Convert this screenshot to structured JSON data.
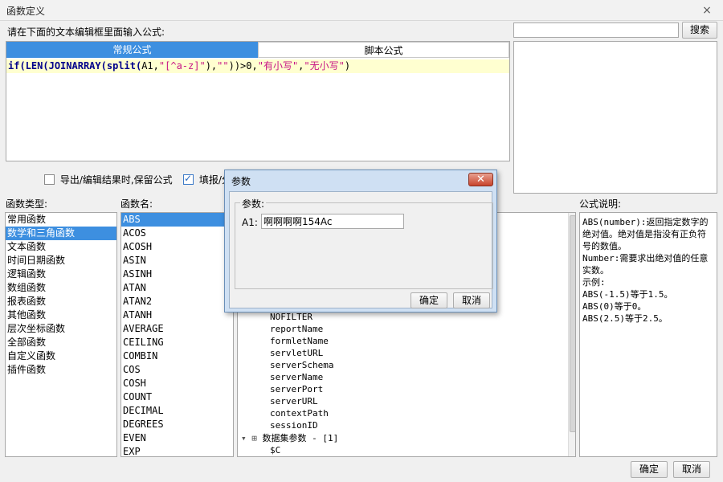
{
  "window": {
    "title": "函数定义",
    "close_label": "×"
  },
  "prompt_label": "请在下面的文本编辑框里面输入公式:",
  "search": {
    "value": "",
    "button_label": "搜索"
  },
  "tabs": [
    {
      "label": "常规公式"
    },
    {
      "label": "脚本公式"
    }
  ],
  "formula_tokens": [
    {
      "t": "if(",
      "c": "kw"
    },
    {
      "t": "LEN(",
      "c": "kw"
    },
    {
      "t": "JOINARRAY(",
      "c": "kw"
    },
    {
      "t": "split(",
      "c": "kw"
    },
    {
      "t": "A1,",
      "c": "plain"
    },
    {
      "t": "\"[^a-z]\"",
      "c": "str"
    },
    {
      "t": "),",
      "c": "plain"
    },
    {
      "t": "\"\"",
      "c": "str"
    },
    {
      "t": "))>0,",
      "c": "plain"
    },
    {
      "t": "\"有小写\"",
      "c": "str"
    },
    {
      "t": ",",
      "c": "plain"
    },
    {
      "t": "\"无小写\"",
      "c": "str"
    },
    {
      "t": ")",
      "c": "plain"
    }
  ],
  "options": {
    "keep_formula_label": "导出/编辑结果时,保留公式",
    "fill_label": "填报/分"
  },
  "function_types": {
    "header": "函数类型:",
    "items": [
      "常用函数",
      "数学和三角函数",
      "文本函数",
      "时间日期函数",
      "逻辑函数",
      "数组函数",
      "报表函数",
      "其他函数",
      "层次坐标函数",
      "全部函数",
      "自定义函数",
      "插件函数"
    ],
    "selected_index": 1
  },
  "function_names": {
    "header": "函数名:",
    "items": [
      "ABS",
      "ACOS",
      "ACOSH",
      "ASIN",
      "ASINH",
      "ATAN",
      "ATAN2",
      "ATANH",
      "AVERAGE",
      "CEILING",
      "COMBIN",
      "COS",
      "COSH",
      "COUNT",
      "DECIMAL",
      "DEGREES",
      "EVEN",
      "EXP"
    ],
    "selected_index": 0
  },
  "params_tree": {
    "items": [
      "NOFILTER",
      "reportName",
      "formletName",
      "servletURL",
      "serverSchema",
      "serverName",
      "serverPort",
      "serverURL",
      "contextPath",
      "sessionID"
    ],
    "group_label": "数据集参数 - [1]",
    "group_item": "$C"
  },
  "description": {
    "header": "公式说明:",
    "text": "ABS(number):返回指定数字的绝对值。绝对值是指没有正负符号的数值。\nNumber:需要求出绝对值的任意实数。\n示例:\nABS(-1.5)等于1.5。\nABS(0)等于0。\nABS(2.5)等于2.5。"
  },
  "footer": {
    "ok_label": "确定",
    "cancel_label": "取消"
  },
  "param_dialog": {
    "title": "参数",
    "close_label": "✕",
    "group_label": "参数:",
    "field_label": "A1:",
    "field_value": "啊啊啊啊154Ac",
    "ok_label": "确定",
    "cancel_label": "取消"
  }
}
